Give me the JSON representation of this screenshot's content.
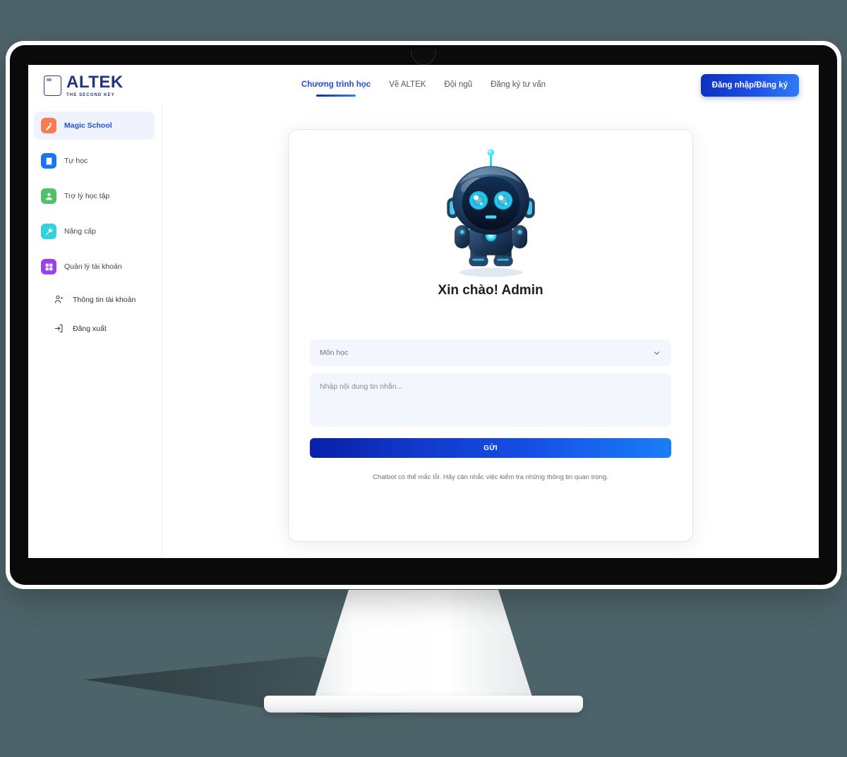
{
  "brand": {
    "logo_word": "ALTEK",
    "logo_tagline": "THE SECOND KEY",
    "logo_mark_icon": "altek-square-icon",
    "accent_color": "#1f4fd8",
    "brand_navy": "#22357e"
  },
  "header": {
    "nav": [
      {
        "label": "Chương trình học",
        "active": true
      },
      {
        "label": "Về ALTEK",
        "active": false
      },
      {
        "label": "Đội ngũ",
        "active": false
      },
      {
        "label": "Đăng ký tư vấn",
        "active": false
      }
    ],
    "login_label": "Đăng nhập/Đăng ký"
  },
  "sidebar": {
    "items": [
      {
        "label": "Magic School",
        "icon": "magic-wand-icon",
        "color": "#f97b4f",
        "active": true
      },
      {
        "label": "Tự học",
        "icon": "book-icon",
        "color": "#1976f0",
        "active": false
      },
      {
        "label": "Trợ lý học tập",
        "icon": "user-icon",
        "color": "#4ec16a",
        "active": false
      },
      {
        "label": "Nâng cấp",
        "icon": "wrench-icon",
        "color": "#2fd4e0",
        "active": false
      },
      {
        "label": "Quản lý tài khoản",
        "icon": "grid-icon",
        "color": "#9b3ff0",
        "active": false
      }
    ],
    "sub_items": [
      {
        "label": "Thông tin tài khoản",
        "icon": "user-plus-icon"
      },
      {
        "label": "Đăng xuất",
        "icon": "logout-icon"
      }
    ]
  },
  "chat": {
    "mascot_icon": "robot-mascot-icon",
    "greeting": "Xin chào! Admin",
    "subject_select": {
      "value": "Môn học",
      "chevron_icon": "chevron-down-icon"
    },
    "message_placeholder": "Nhập nội dung tin nhắn...",
    "message_value": "",
    "send_label": "GỬI",
    "disclaimer": "Chatbot có thể mắc lỗi. Hãy cân nhắc việc kiểm tra những thông tin quan trọng."
  },
  "device": {
    "type": "desktop-monitor",
    "background_color": "#4c6369"
  }
}
